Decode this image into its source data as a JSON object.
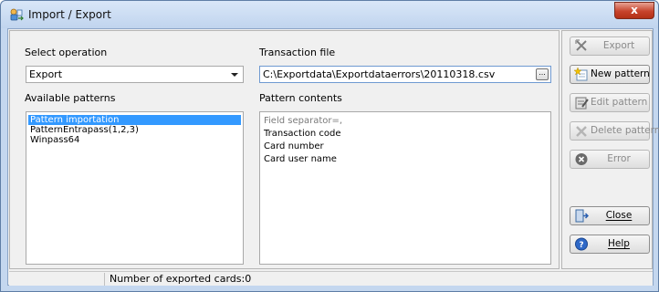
{
  "window": {
    "title": "Import / Export",
    "close_label": "x"
  },
  "operation": {
    "label": "Select operation",
    "value": "Export"
  },
  "transaction": {
    "label": "Transaction file",
    "value": "C:\\Exportdata\\Exportdataerrors\\20110318.csv",
    "browse_label": "..."
  },
  "patterns": {
    "label": "Available patterns",
    "items": [
      {
        "label": "Pattern importation",
        "selected": true
      },
      {
        "label": "PatternEntrapass(1,2,3)",
        "selected": false
      },
      {
        "label": "Winpass64",
        "selected": false
      }
    ]
  },
  "contents": {
    "label": "Pattern contents",
    "items": [
      {
        "label": "Field separator=,",
        "muted": true
      },
      {
        "label": "Transaction code",
        "muted": false
      },
      {
        "label": "Card number",
        "muted": false
      },
      {
        "label": "Card user name",
        "muted": false
      }
    ]
  },
  "actions": {
    "export": {
      "label": "Export",
      "icon": "export-icon",
      "enabled": false
    },
    "new_pattern": {
      "label": "New pattern",
      "icon": "new-pattern-icon",
      "enabled": true
    },
    "edit_pattern": {
      "label": "Edit pattern",
      "icon": "edit-pattern-icon",
      "enabled": false
    },
    "delete_pattern": {
      "label": "Delete pattern",
      "icon": "delete-pattern-icon",
      "enabled": false
    },
    "error": {
      "label": "Error",
      "icon": "error-icon",
      "enabled": false
    },
    "close": {
      "label": "Close",
      "icon": "door-exit-icon",
      "enabled": true
    },
    "help": {
      "label": "Help",
      "icon": "help-icon",
      "enabled": true
    }
  },
  "status": {
    "text": "Number of exported cards:0"
  },
  "colors": {
    "selection": "#3399ff",
    "frame": "#c4d7ef",
    "close_button": "#c7432c"
  }
}
